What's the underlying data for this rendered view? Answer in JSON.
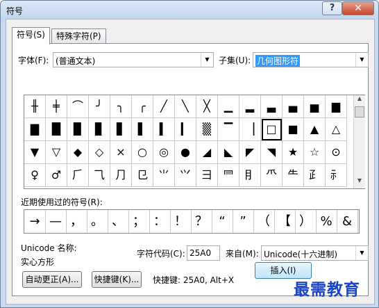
{
  "window": {
    "title": "符号",
    "help_glyph": "?",
    "close_glyph": "✕"
  },
  "tabs": [
    {
      "label": "符号(S)",
      "active": true
    },
    {
      "label": "特殊字符(P)",
      "active": false
    }
  ],
  "font": {
    "label": "字体(F):",
    "value": "(普通文本)"
  },
  "subset": {
    "label": "子集(U):",
    "value": "几何图形符"
  },
  "symbol_grid": {
    "rows": [
      [
        "╫",
        "╪",
        "⌒",
        "╯",
        "╮",
        "╭",
        "╱",
        "╲",
        "╳",
        "▁",
        "▂",
        "▃",
        "▄",
        "▅",
        "▆"
      ],
      [
        "▇",
        "█",
        "▉",
        "▊",
        "▋",
        "▌",
        "▍",
        "▎",
        "▒",
        "▔",
        "▕",
        "□",
        "■",
        "▲",
        "△"
      ],
      [
        "▼",
        "▽",
        "◆",
        "◇",
        "×",
        "○",
        "◎",
        "●",
        "◢",
        "◣",
        "◤",
        "◥",
        "★",
        "☆",
        "⊙"
      ],
      [
        "♀",
        "♂",
        "⺁",
        "⺄",
        "⺆",
        "⺋",
        "⺌",
        "⺍",
        "⺕",
        "⺜",
        "⺝",
        "⺥",
        "⺧",
        "⺪",
        "⺬"
      ]
    ],
    "selected_row": 1,
    "selected_col": 11
  },
  "recent": {
    "label": "近期使用过的符号(R):",
    "symbols": [
      "→",
      "—",
      "，",
      "。",
      "、",
      "；",
      "：",
      "！",
      "？",
      "“",
      "”",
      "（",
      "【",
      "）",
      "%",
      "&"
    ]
  },
  "unicode_name": {
    "label": "Unicode 名称:",
    "value": "实心方形"
  },
  "char_code": {
    "label": "字符代码(C):",
    "value": "25A0"
  },
  "from": {
    "label": "来自(M):",
    "value": "Unicode(十六进制)"
  },
  "buttons": {
    "autocorrect": "自动更正(A)...",
    "shortcut_key": "快捷键(K)...",
    "insert": "插入(I)"
  },
  "shortcut_text": "快捷键: 25A0, Alt+X",
  "watermark": "最需教育"
}
